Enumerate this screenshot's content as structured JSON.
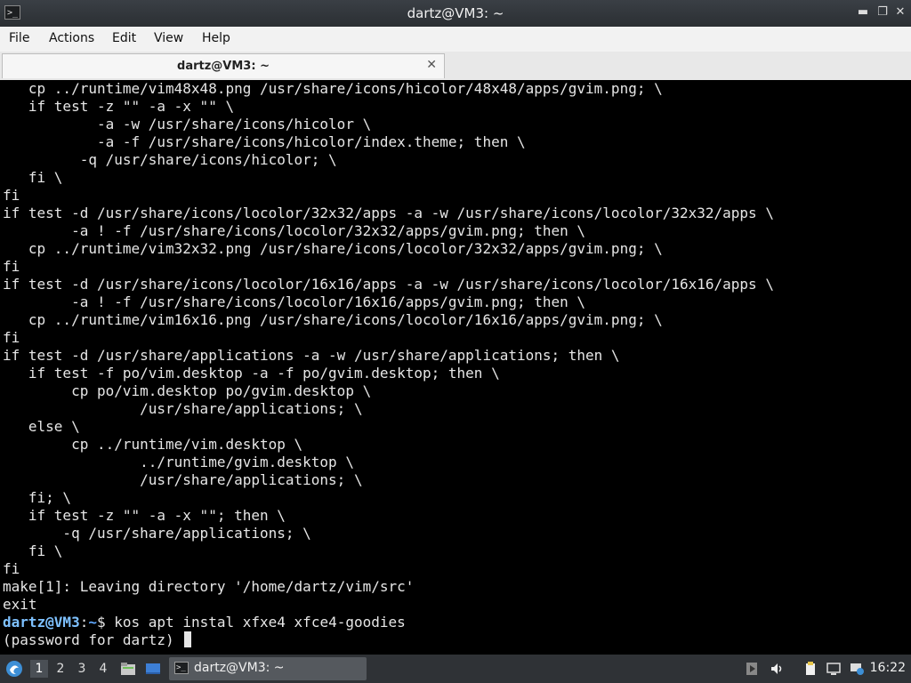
{
  "window": {
    "title": "dartz@VM3: ~",
    "app_icon_glyph": ">_",
    "controls": {
      "minimize": "▬",
      "maximize": "❐",
      "close": "✕"
    }
  },
  "menu": [
    "File",
    "Actions",
    "Edit",
    "View",
    "Help"
  ],
  "tab": {
    "label": "dartz@VM3: ~",
    "close": "✕"
  },
  "terminal": {
    "lines": [
      "   cp ../runtime/vim48x48.png /usr/share/icons/hicolor/48x48/apps/gvim.png; \\",
      "   if test -z \"\" -a -x \"\" \\",
      "           -a -w /usr/share/icons/hicolor \\",
      "           -a -f /usr/share/icons/hicolor/index.theme; then \\",
      "         -q /usr/share/icons/hicolor; \\",
      "   fi \\",
      "fi",
      "if test -d /usr/share/icons/locolor/32x32/apps -a -w /usr/share/icons/locolor/32x32/apps \\",
      "        -a ! -f /usr/share/icons/locolor/32x32/apps/gvim.png; then \\",
      "   cp ../runtime/vim32x32.png /usr/share/icons/locolor/32x32/apps/gvim.png; \\",
      "fi",
      "if test -d /usr/share/icons/locolor/16x16/apps -a -w /usr/share/icons/locolor/16x16/apps \\",
      "        -a ! -f /usr/share/icons/locolor/16x16/apps/gvim.png; then \\",
      "   cp ../runtime/vim16x16.png /usr/share/icons/locolor/16x16/apps/gvim.png; \\",
      "fi",
      "if test -d /usr/share/applications -a -w /usr/share/applications; then \\",
      "   if test -f po/vim.desktop -a -f po/gvim.desktop; then \\",
      "        cp po/vim.desktop po/gvim.desktop \\",
      "                /usr/share/applications; \\",
      "   else \\",
      "        cp ../runtime/vim.desktop \\",
      "                ../runtime/gvim.desktop \\",
      "                /usr/share/applications; \\",
      "   fi; \\",
      "   if test -z \"\" -a -x \"\"; then \\",
      "       -q /usr/share/applications; \\",
      "   fi \\",
      "fi",
      "make[1]: Leaving directory '/home/dartz/vim/src'",
      "exit"
    ],
    "prompt_user": "dartz@VM3",
    "prompt_sep": ":",
    "prompt_path": "~",
    "prompt_symbol": "$",
    "command": " kos apt instal xfxe4 xfce4-goodies",
    "password_prompt": "(password for dartz) "
  },
  "taskbar": {
    "workspaces": [
      "1",
      "2",
      "3",
      "4"
    ],
    "active_workspace": "1",
    "task_label": "dartz@VM3: ~",
    "clock": "16:22"
  },
  "colors": {
    "prompt": "#7ec1ff",
    "terminal_bg": "#000000",
    "terminal_fg": "#e6e6e6"
  }
}
